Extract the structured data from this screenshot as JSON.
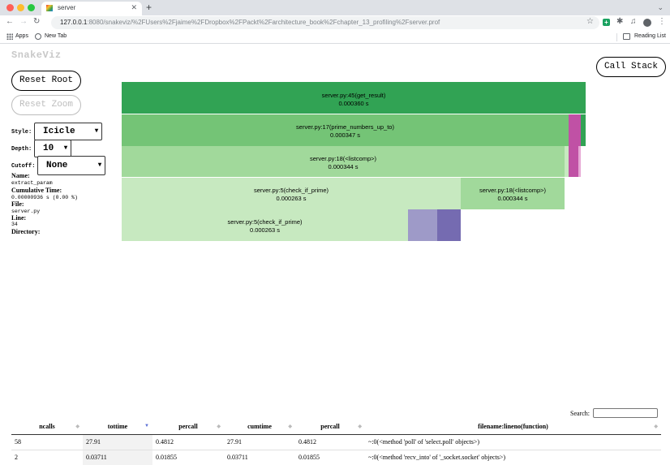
{
  "browser": {
    "tab_title": "server",
    "url_host": "127.0.0.1",
    "url_path": ":8080/snakeviz/%2FUsers%2Fjaime%2FDropbox%2FPackt%2Farchitecture_book%2Fchapter_13_profiling%2Fserver.prof",
    "bookmarks": [
      "Apps",
      "New Tab"
    ],
    "reading_list": "Reading List",
    "colors": {
      "close": "#ff5f57",
      "minimize": "#febc2e",
      "zoom": "#28c840"
    }
  },
  "app": {
    "logo": "SnakeViz",
    "reset_root": "Reset Root",
    "reset_zoom": "Reset Zoom",
    "call_stack": "Call Stack",
    "style_label": "Style:",
    "style_value": "Icicle",
    "depth_label": "Depth:",
    "depth_value": "10",
    "cutoff_label": "Cutoff:",
    "cutoff_value": "None"
  },
  "info": {
    "name_label": "Name:",
    "name_value": "extract_param",
    "cumtime_label": "Cumulative Time:",
    "cumtime_value": "0.00000936 s (0.00 %)",
    "file_label": "File:",
    "file_value": "server.py",
    "line_label": "Line:",
    "line_value": "34",
    "dir_label": "Directory:"
  },
  "icicle": [
    {
      "label": "server.py:45(get_result)",
      "time": "0.000360 s",
      "color": "#31a354"
    },
    {
      "label": "server.py:17(prime_numbers_up_to)",
      "time": "0.000347 s",
      "color": "#74c476"
    },
    {
      "label": "server.py:18(<listcomp>)",
      "time": "0.000344 s",
      "color": "#a1d99b"
    },
    {
      "label": "server.py:5(check_if_prime)",
      "time": "0.000263 s",
      "color": "#c7e9c0"
    },
    {
      "label": "server.py:18(<listcomp>)",
      "time": "0.000344 s",
      "color": "#a1d99b"
    },
    {
      "label": "server.py:5(check_if_prime)",
      "time": "0.000263 s",
      "color": "#c7e9c0"
    }
  ],
  "icicle_colors": {
    "magenta": "#c051a5",
    "light_magenta": "#e7a9d6",
    "purple_light": "#9e9ac8",
    "purple": "#756bb1"
  },
  "table": {
    "search_label": "Search:",
    "headers": [
      "ncalls",
      "tottime",
      "percall",
      "cumtime",
      "percall",
      "filename:lineno(function)"
    ],
    "rows": [
      [
        "58",
        "27.91",
        "0.4812",
        "27.91",
        "0.4812",
        "~:0(<method 'poll' of 'select.poll' objects>)"
      ],
      [
        "2",
        "0.03711",
        "0.01855",
        "0.03711",
        "0.01855",
        "~:0(<method 'recv_into' of '_socket.socket' objects>)"
      ]
    ]
  }
}
